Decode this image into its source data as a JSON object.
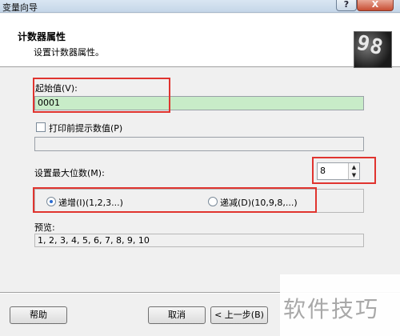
{
  "window": {
    "title": "变量向导",
    "help_glyph": "?",
    "close_glyph": "X"
  },
  "header": {
    "title": "计数器属性",
    "subtitle": "设置计数器属性。",
    "icon_text": "98"
  },
  "start_value": {
    "label": "起始值(V):",
    "value": "0001"
  },
  "prompt": {
    "checkbox_label": "打印前提示数值(P)",
    "checked": false,
    "value": ""
  },
  "max_digits": {
    "label": "设置最大位数(M):",
    "value": "8",
    "up_glyph": "▲",
    "down_glyph": "▼"
  },
  "direction": {
    "increment_label": "递增(I)(1,2,3...)",
    "decrement_label": "递减(D)(10,9,8,...)",
    "selected": "increment"
  },
  "preview": {
    "label": "预览:",
    "value": "1, 2, 3, 4, 5, 6, 7, 8, 9, 10"
  },
  "buttons": {
    "help": "帮助",
    "cancel": "取消",
    "back": "< 上一步(B)"
  },
  "watermark": "软件技巧",
  "colors": {
    "highlight": "#e0342f",
    "start_field_bg": "#c8ecc8"
  }
}
